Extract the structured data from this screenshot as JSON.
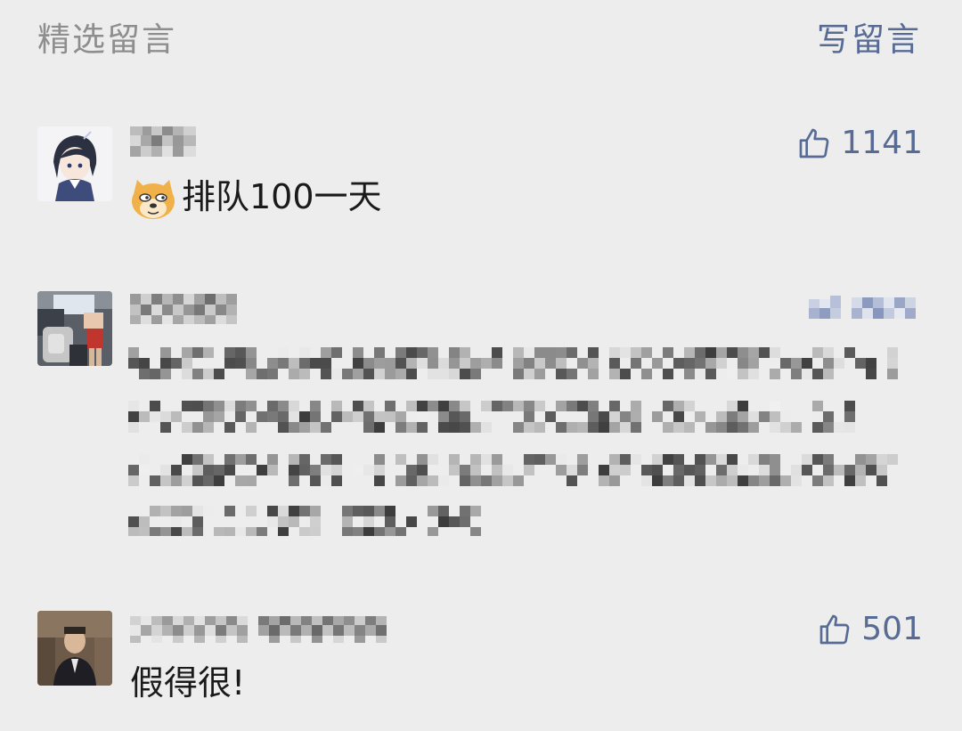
{
  "header": {
    "title": "精选留言",
    "write_label": "写留言"
  },
  "comments": [
    {
      "nickname_pixelated": true,
      "content": "排队100一天",
      "emoji": "doge-emoji",
      "likes": "1141"
    },
    {
      "nickname_pixelated": true,
      "content_pixelated": true,
      "likes_pixelated": true
    },
    {
      "nickname_pixelated": true,
      "content": "假得很!",
      "likes": "501"
    }
  ],
  "colors": {
    "background": "#ededed",
    "link": "#576b95",
    "header_text": "#8e8e8e",
    "body_text": "#1a1a1a"
  },
  "icons": [
    "thumbs-up-icon",
    "doge-emoji"
  ]
}
